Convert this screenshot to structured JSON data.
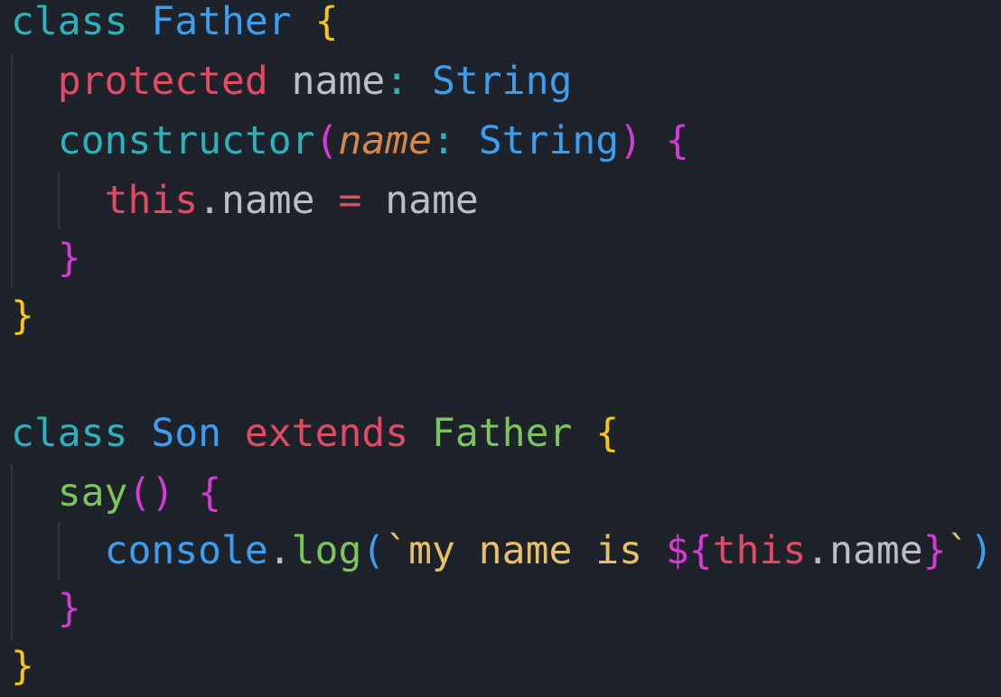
{
  "editor": {
    "line1": {
      "kw": "class",
      "name": "Father",
      "brace": "{"
    },
    "line2": {
      "modifier": "protected",
      "prop": "name",
      "colon": ":",
      "type": "String"
    },
    "line3": {
      "ctor": "constructor",
      "open": "(",
      "param": "name",
      "colon": ":",
      "type": "String",
      "close": ")",
      "brace": "{"
    },
    "line4": {
      "this": "this",
      "dot": ".",
      "prop": "name",
      "eq": "=",
      "value": "name"
    },
    "line5": {
      "brace": "}"
    },
    "line6": {
      "brace": "}"
    },
    "line8": {
      "kw": "class",
      "name": "Son",
      "extends": "extends",
      "super": "Father",
      "brace": "{"
    },
    "line9": {
      "method": "say",
      "parens": "()",
      "brace": "{"
    },
    "line10": {
      "console": "console",
      "dot": ".",
      "log": "log",
      "open": "(",
      "bq1": "`",
      "text": "my name is ",
      "tpl_open": "${",
      "this": "this",
      "dot2": ".",
      "prop": "name",
      "tpl_close": "}",
      "bq2": "`",
      "close": ")"
    },
    "line11": {
      "brace": "}"
    },
    "line12": {
      "brace": "}"
    }
  }
}
